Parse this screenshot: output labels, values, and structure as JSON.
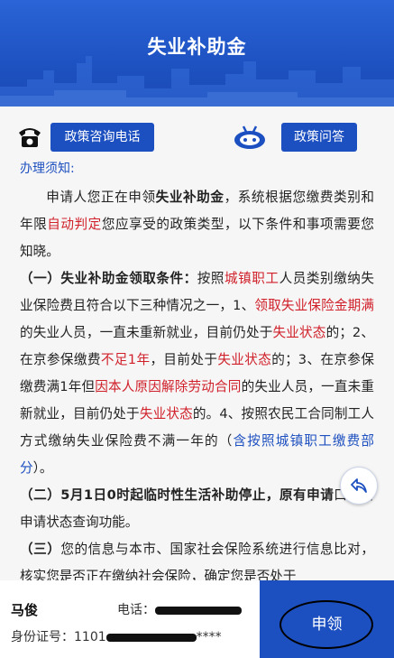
{
  "header": {
    "title": "失业补助金"
  },
  "buttons": {
    "policy_phone": "政策咨询电话",
    "policy_qa": "政策问答"
  },
  "notice": {
    "label": "办理须知:",
    "p1": {
      "s1": "申请人您正在申领",
      "s2": "失业补助金",
      "s3": "，系统根据您缴费类别和年限",
      "s4": "自动判定",
      "s5": "您应享受的政策类型，以下条件和事项需要您知晓。"
    },
    "p2": {
      "s1": "（一）失业补助金领取条件：",
      "s2": "按照",
      "s3": "城镇职工",
      "s4": "人员类别缴纳失业保险费且符合以下三种情况之一，1、",
      "s5": "领取失业保险金期满",
      "s6": "的失业人员，一直未重新就业，目前仍处于",
      "s7": "失业状态",
      "s8": "的；2、在京参保缴费",
      "s9": "不足1年",
      "s10": "，目前处于",
      "s11": "失业状态",
      "s12": "的；3、在京参保缴费满1年但",
      "s13": "因本人原因解除劳动合同",
      "s14": "的失业人员，一直未重新就业，目前仍处于",
      "s15": "失业状态",
      "s16": "的。4、按照农民工合同制工人方式缴纳失业保险费不满一年的（",
      "s17": "含按照城镇职工缴费部分",
      "s18": "）。"
    },
    "p3": {
      "s1": "（二）5月1日0时起临时性生活补助停止，原有申请",
      "s2": "口保留申请状态查询功能。"
    },
    "p4": {
      "s1": "（三）",
      "s2": "您的信息与本市、国家社会保险系统进行信息比对，核实您是否正在缴纳社会保险，确定您是否处于"
    }
  },
  "footer": {
    "name": "马俊",
    "phone_label": "电话：",
    "id_label": "身份证号：",
    "id_prefix": "1101",
    "id_suffix": "****",
    "apply_label": "申领"
  },
  "colors": {
    "brand_blue": "#1c4fc0",
    "highlight_red": "#d0202a"
  },
  "icons": [
    "telephone-icon",
    "robot-icon",
    "share-icon"
  ]
}
